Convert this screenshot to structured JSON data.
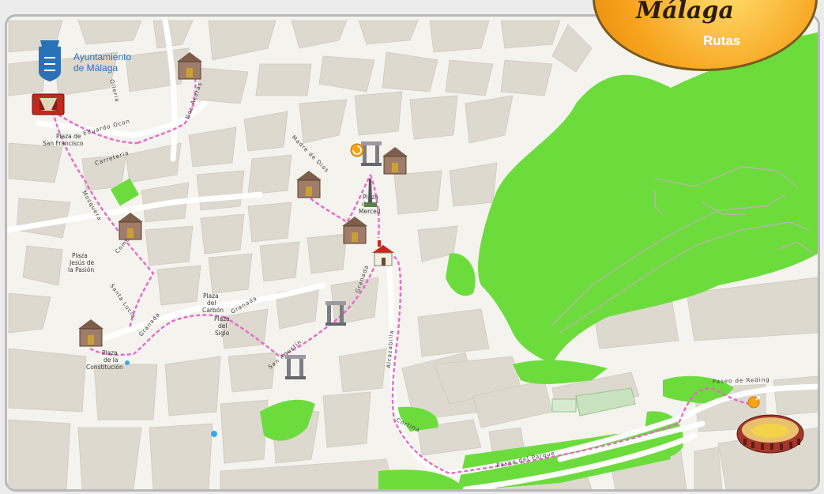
{
  "header": {
    "organization_line1": "Ayuntamiento",
    "organization_line2": "de Málaga",
    "brand": "Málaga",
    "section": "Rutas"
  },
  "places": {
    "plaza_san_francisco_1": "Plaza de",
    "plaza_san_francisco_2": "San Francisco",
    "plaza_jesus_1": "Plaza",
    "plaza_jesus_2": "Jesús de",
    "plaza_jesus_3": "la Pasión",
    "plaza_carbon_1": "Plaza",
    "plaza_carbon_2": "del",
    "plaza_carbon_3": "Carbón",
    "plaza_siglo_1": "Plaza",
    "plaza_siglo_2": "del",
    "plaza_siglo_3": "Siglo",
    "plaza_constitucion_1": "Plaza",
    "plaza_constitucion_2": "de la",
    "plaza_constitucion_3": "Constitución",
    "plaza_merced_1": "Plaza",
    "plaza_merced_2": "de la",
    "plaza_merced_3": "Merced"
  },
  "streets": {
    "olleria": "Olleria",
    "dos_aceras": "Dos Aceras",
    "eduardo_ocon": "Eduardo Ocon",
    "carreteria": "Carreteria",
    "madre_de_dios": "Madre de Dios",
    "mosquera": "Mosquera",
    "comedias": "Comedias",
    "santa_lucia": "Santa Lucía",
    "granada_1": "Granada",
    "granada_2": "Granada",
    "granada_3": "Granada",
    "san_agustin": "San Agustín",
    "alcazabilla": "Alcazabilla",
    "paseo_de_reding": "Paseo de Reding",
    "paseo_del_parque": "Paseo del Parque",
    "cortina": "Cortina"
  },
  "icons": {
    "municipal_shield": "municipal-shield-icon",
    "theatre": "theatre-icon",
    "museum": "museum-icon",
    "ruins": "roman-ruins-icon",
    "church": "church-icon",
    "monument": "obelisk-icon",
    "bullring": "bullring-icon",
    "start_marker": "start-marker-icon",
    "end_marker": "end-marker-icon",
    "fountain": "fountain-dot-icon"
  },
  "colors": {
    "route": "#e56ac8",
    "park": "#6cdc3c",
    "block": "#ddd9cf",
    "street": "#f4f3ee",
    "badge": "#f7a21c",
    "link_blue": "#2a72b8"
  }
}
